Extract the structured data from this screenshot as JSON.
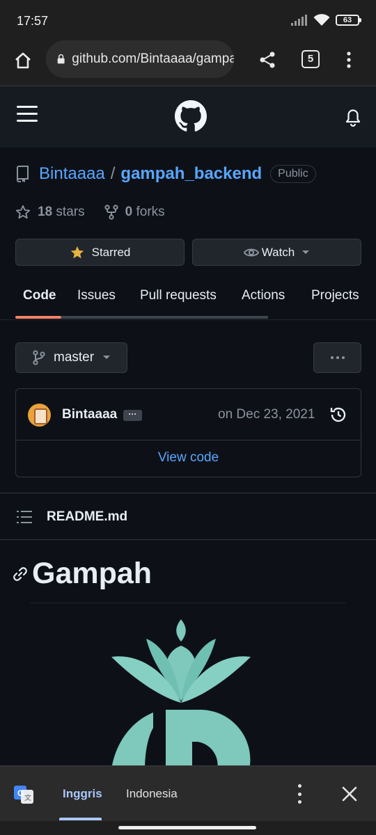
{
  "status_bar": {
    "time": "17:57",
    "battery": "63"
  },
  "browser": {
    "url": "github.com/Bintaaaa/gampah_backend",
    "tab_count": "5"
  },
  "repo": {
    "owner": "Bintaaaa",
    "separator": "/",
    "name": "gampah_backend",
    "visibility": "Public",
    "stars_count": "18",
    "stars_label": "stars",
    "forks_count": "0",
    "forks_label": "forks",
    "star_button": "Starred",
    "watch_button": "Watch"
  },
  "tabs": [
    {
      "label": "Code"
    },
    {
      "label": "Issues"
    },
    {
      "label": "Pull requests"
    },
    {
      "label": "Actions"
    },
    {
      "label": "Projects"
    }
  ],
  "branch": {
    "name": "master"
  },
  "commit": {
    "author": "Bintaaaa",
    "ellipsis": "···",
    "date": "on Dec 23, 2021",
    "view_code": "View code"
  },
  "readme": {
    "filename": "README.md",
    "heading": "Gampah"
  },
  "translate": {
    "source_lang": "Inggris",
    "target_lang": "Indonesia"
  },
  "colors": {
    "link": "#58a6ff",
    "tab_underline": "#f78166",
    "logo": "#7ec8bc",
    "translate_active": "#a8c7fa",
    "star": "#e3b341"
  }
}
